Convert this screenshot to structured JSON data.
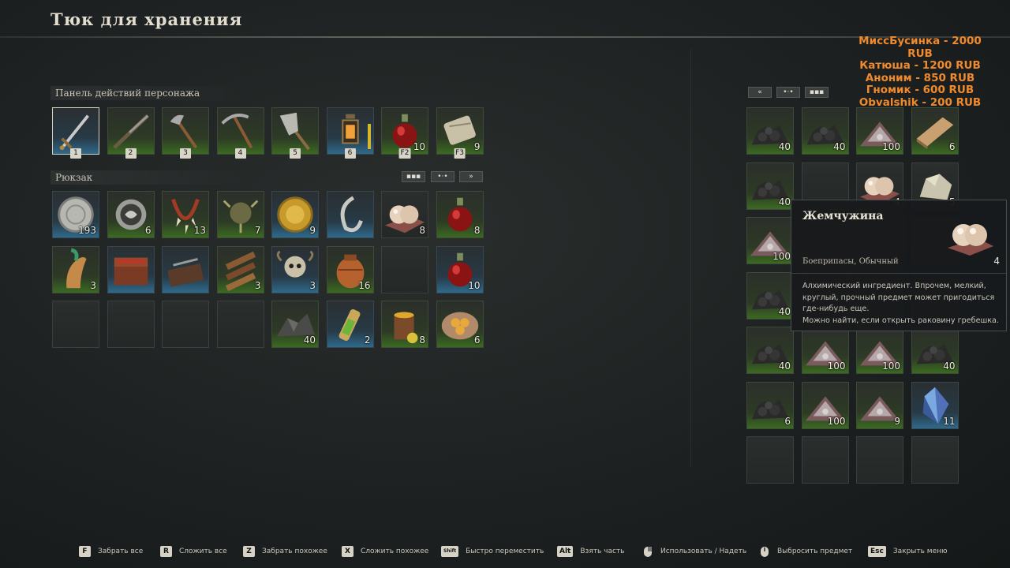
{
  "window": {
    "title": "Тюк для хранения"
  },
  "donors": [
    "МиссБусинка - 2000 RUB",
    "Катюша - 1200 RUB",
    "Аноним - 850 RUB",
    "Гномик - 600 RUB",
    "Obvalshik - 200 RUB"
  ],
  "action_bar": {
    "label": "Панель действий персонажа",
    "slots": [
      {
        "item": "sword-icon",
        "hotkey": "1",
        "qty": "",
        "rarity": "blue",
        "selected": true
      },
      {
        "item": "musket-icon",
        "hotkey": "2",
        "qty": "",
        "rarity": "green"
      },
      {
        "item": "axe-icon",
        "hotkey": "3",
        "qty": "",
        "rarity": "green"
      },
      {
        "item": "pickaxe-icon",
        "hotkey": "4",
        "qty": "",
        "rarity": "green"
      },
      {
        "item": "shovel-icon",
        "hotkey": "5",
        "qty": "",
        "rarity": "green"
      },
      {
        "item": "lantern-icon",
        "hotkey": "6",
        "qty": "",
        "rarity": "blue",
        "charge": true
      },
      {
        "item": "potion-icon",
        "hotkey": "F2",
        "qty": "10",
        "rarity": "green"
      },
      {
        "item": "bandage-icon",
        "hotkey": "F3",
        "qty": "9",
        "rarity": "green"
      }
    ]
  },
  "backpack": {
    "label": "Рюкзак",
    "buttons": [
      "▪▪▪",
      "•·•",
      "»"
    ],
    "rows": [
      [
        {
          "item": "silver-coin-icon",
          "qty": "193",
          "rarity": "blue"
        },
        {
          "item": "medallion-icon",
          "qty": "6",
          "rarity": "green"
        },
        {
          "item": "tooth-necklace-icon",
          "qty": "13",
          "rarity": "green"
        },
        {
          "item": "trophy-icon",
          "qty": "7",
          "rarity": "green"
        },
        {
          "item": "gold-coin-icon",
          "qty": "9",
          "rarity": "blue"
        },
        {
          "item": "earring-icon",
          "qty": "",
          "rarity": "blue"
        },
        {
          "item": "pearl-icon",
          "qty": "8",
          "rarity": ""
        },
        {
          "item": "potion-icon",
          "qty": "8",
          "rarity": "green"
        }
      ],
      [
        {
          "item": "rooster-icon",
          "qty": "3",
          "rarity": "green"
        },
        {
          "item": "chest-icon",
          "qty": "",
          "rarity": "blue"
        },
        {
          "item": "toolbox-icon",
          "qty": "",
          "rarity": "blue"
        },
        {
          "item": "planks-icon",
          "qty": "3",
          "rarity": "green"
        },
        {
          "item": "skull-trophy-icon",
          "qty": "3",
          "rarity": "blue"
        },
        {
          "item": "jar-icon",
          "qty": "16",
          "rarity": "green"
        },
        {
          "item": "",
          "qty": "",
          "rarity": ""
        },
        {
          "item": "potion-icon",
          "qty": "10",
          "rarity": "blue"
        }
      ],
      [
        {
          "item": "",
          "qty": "",
          "rarity": ""
        },
        {
          "item": "",
          "qty": "",
          "rarity": ""
        },
        {
          "item": "",
          "qty": "",
          "rarity": ""
        },
        {
          "item": "",
          "qty": "",
          "rarity": ""
        },
        {
          "item": "ore-icon",
          "qty": "40",
          "rarity": "green"
        },
        {
          "item": "vial-icon",
          "qty": "2",
          "rarity": "blue"
        },
        {
          "item": "drink-icon",
          "qty": "8",
          "rarity": "green"
        },
        {
          "item": "food-plate-icon",
          "qty": "6",
          "rarity": "green"
        }
      ]
    ]
  },
  "storage": {
    "buttons": [
      "«",
      "•·•",
      "▪▪▪"
    ],
    "rows": [
      [
        {
          "item": "coal-icon",
          "qty": "40",
          "rarity": "green"
        },
        {
          "item": "coal-icon",
          "qty": "40",
          "rarity": "green"
        },
        {
          "item": "iron-ore-icon",
          "qty": "100",
          "rarity": "green"
        },
        {
          "item": "ingot-icon",
          "qty": "6",
          "rarity": "green"
        }
      ],
      [
        {
          "item": "coal-icon",
          "qty": "40",
          "rarity": "green"
        },
        {
          "item": "",
          "qty": "",
          "rarity": ""
        },
        {
          "item": "pearl-icon",
          "qty": "4",
          "rarity": ""
        },
        {
          "item": "stone-icon",
          "qty": "5",
          "rarity": ""
        }
      ],
      [
        {
          "item": "iron-ore-icon",
          "qty": "100",
          "rarity": "green"
        },
        {
          "item": "",
          "qty": "",
          "rarity": ""
        },
        {
          "item": "",
          "qty": "",
          "rarity": ""
        },
        {
          "item": "",
          "qty": "",
          "rarity": ""
        }
      ],
      [
        {
          "item": "coal-icon",
          "qty": "40",
          "rarity": "green"
        },
        {
          "item": "",
          "qty": "",
          "rarity": ""
        },
        {
          "item": "",
          "qty": "",
          "rarity": ""
        },
        {
          "item": "",
          "qty": "",
          "rarity": ""
        }
      ],
      [
        {
          "item": "coal-icon",
          "qty": "40",
          "rarity": "green"
        },
        {
          "item": "iron-ore-icon",
          "qty": "100",
          "rarity": "green"
        },
        {
          "item": "iron-ore-icon",
          "qty": "100",
          "rarity": "green"
        },
        {
          "item": "coal-icon",
          "qty": "40",
          "rarity": "green"
        }
      ],
      [
        {
          "item": "coal-icon",
          "qty": "6",
          "rarity": "green"
        },
        {
          "item": "iron-ore-icon",
          "qty": "100",
          "rarity": "green"
        },
        {
          "item": "iron-ore-icon",
          "qty": "9",
          "rarity": "green"
        },
        {
          "item": "crystal-icon",
          "qty": "11",
          "rarity": "blue"
        }
      ],
      [
        {
          "item": "",
          "qty": "",
          "rarity": ""
        },
        {
          "item": "",
          "qty": "",
          "rarity": ""
        },
        {
          "item": "",
          "qty": "",
          "rarity": ""
        },
        {
          "item": "",
          "qty": "",
          "rarity": ""
        }
      ]
    ]
  },
  "tooltip": {
    "name": "Жемчужина",
    "category": "Боеприпасы, Обычный",
    "qty": "4",
    "icon": "pearl-icon",
    "description": "Алхимический ингредиент. Впрочем, мелкий, круглый, прочный предмет может пригодиться где-нибудь еще.",
    "source": "Можно найти, если открыть раковину гребешка."
  },
  "footer": [
    {
      "key": "F",
      "label": "Забрать все"
    },
    {
      "key": "R",
      "label": "Сложить все"
    },
    {
      "key": "Z",
      "label": "Забрать похожее"
    },
    {
      "key": "X",
      "label": "Сложить похожее"
    },
    {
      "key": "Shift",
      "label": "Быстро переместить"
    },
    {
      "key": "Alt",
      "label": "Взять часть"
    },
    {
      "key": "mouse-right-icon",
      "label": "Использовать / Надеть"
    },
    {
      "key": "mouse-middle-icon",
      "label": "Выбросить предмет"
    },
    {
      "key": "Esc",
      "label": "Закрыть меню"
    }
  ],
  "colors": {
    "background": "#1d2121",
    "donor_text": "#f08a2c",
    "slot_green": "#3b6a22",
    "slot_blue": "#2f6a8c"
  }
}
